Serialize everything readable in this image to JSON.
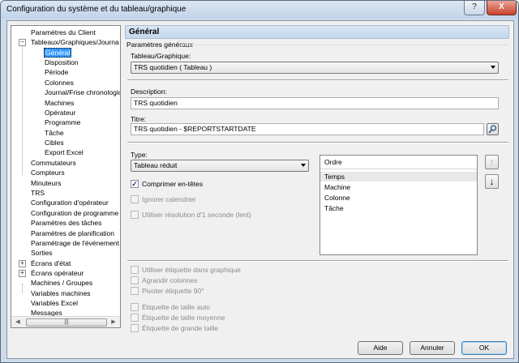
{
  "window": {
    "title": "Configuration du système et du tableau/graphique",
    "help_label": "?",
    "close_label": "X"
  },
  "tree": {
    "items": [
      {
        "label": "Paramètres du Client"
      },
      {
        "label": "Tableaux/Graphiques/Journa"
      },
      {
        "label": "Général"
      },
      {
        "label": "Disposition"
      },
      {
        "label": "Période"
      },
      {
        "label": "Colonnes"
      },
      {
        "label": "Journal/Frise chronologic"
      },
      {
        "label": "Machines"
      },
      {
        "label": "Opérateur"
      },
      {
        "label": "Programme"
      },
      {
        "label": "Tâche"
      },
      {
        "label": "Cibles"
      },
      {
        "label": "Export Excel"
      },
      {
        "label": "Commutateurs"
      },
      {
        "label": "Compteurs"
      },
      {
        "label": "Minuteurs"
      },
      {
        "label": "TRS"
      },
      {
        "label": "Configuration d'opérateur"
      },
      {
        "label": "Configuration de programme"
      },
      {
        "label": "Paramètres des tâches"
      },
      {
        "label": "Paramètres de planification"
      },
      {
        "label": "Paramétrage de l'événement"
      },
      {
        "label": "Sorties"
      },
      {
        "label": "Écrans d'état"
      },
      {
        "label": "Écrans opérateur"
      },
      {
        "label": "Machines / Groupes"
      },
      {
        "label": "Variables machines"
      },
      {
        "label": "Variables Excel"
      },
      {
        "label": "Messages"
      }
    ],
    "expander_open": "−",
    "expander_closed": "+",
    "scroll_left": "◀",
    "scroll_right": "▶",
    "scroll_grip": "|||"
  },
  "panel": {
    "header": "Général",
    "group_label": "Paramètres généraux",
    "table_graph_label": "Tableau/Graphique:",
    "table_graph_value": "TRS quotidien  ( Tableau )",
    "description_label": "Description:",
    "description_value": "TRS quotidien",
    "title_label": "Titre:",
    "title_value": "TRS quotidien - $REPORTSTARTDATE",
    "type_label": "Type:",
    "type_value": "Tableau réduit",
    "checkboxes": [
      {
        "label": "Comprimer en-têtes",
        "checked": true,
        "enabled": true
      },
      {
        "label": "Ignorer calendrier",
        "checked": false,
        "enabled": false
      },
      {
        "label": "Utiliser résolution d'1 seconde (lent)",
        "checked": false,
        "enabled": false
      }
    ],
    "order_header": "Ordre",
    "order_items": [
      "Temps",
      "Machine",
      "Colonne",
      "Tâche"
    ],
    "move_up": "↑",
    "move_down": "↓",
    "bottom_checkboxes": [
      {
        "label": "Utiliser étiquette dans graphique"
      },
      {
        "label": "Agrandir colonnes"
      },
      {
        "label": "Pivoter étiquette 90°"
      },
      {
        "label": "Étiquette de taille auto"
      },
      {
        "label": "Étiquette de taille moyenne"
      },
      {
        "label": "Étiquette de grande taille"
      }
    ],
    "check_mark": "✓"
  },
  "buttons": {
    "help": "Aide",
    "cancel": "Annuler",
    "ok": "OK"
  },
  "colors": {
    "selection": "#3399ff",
    "header_bar": "#c5d7ee"
  }
}
